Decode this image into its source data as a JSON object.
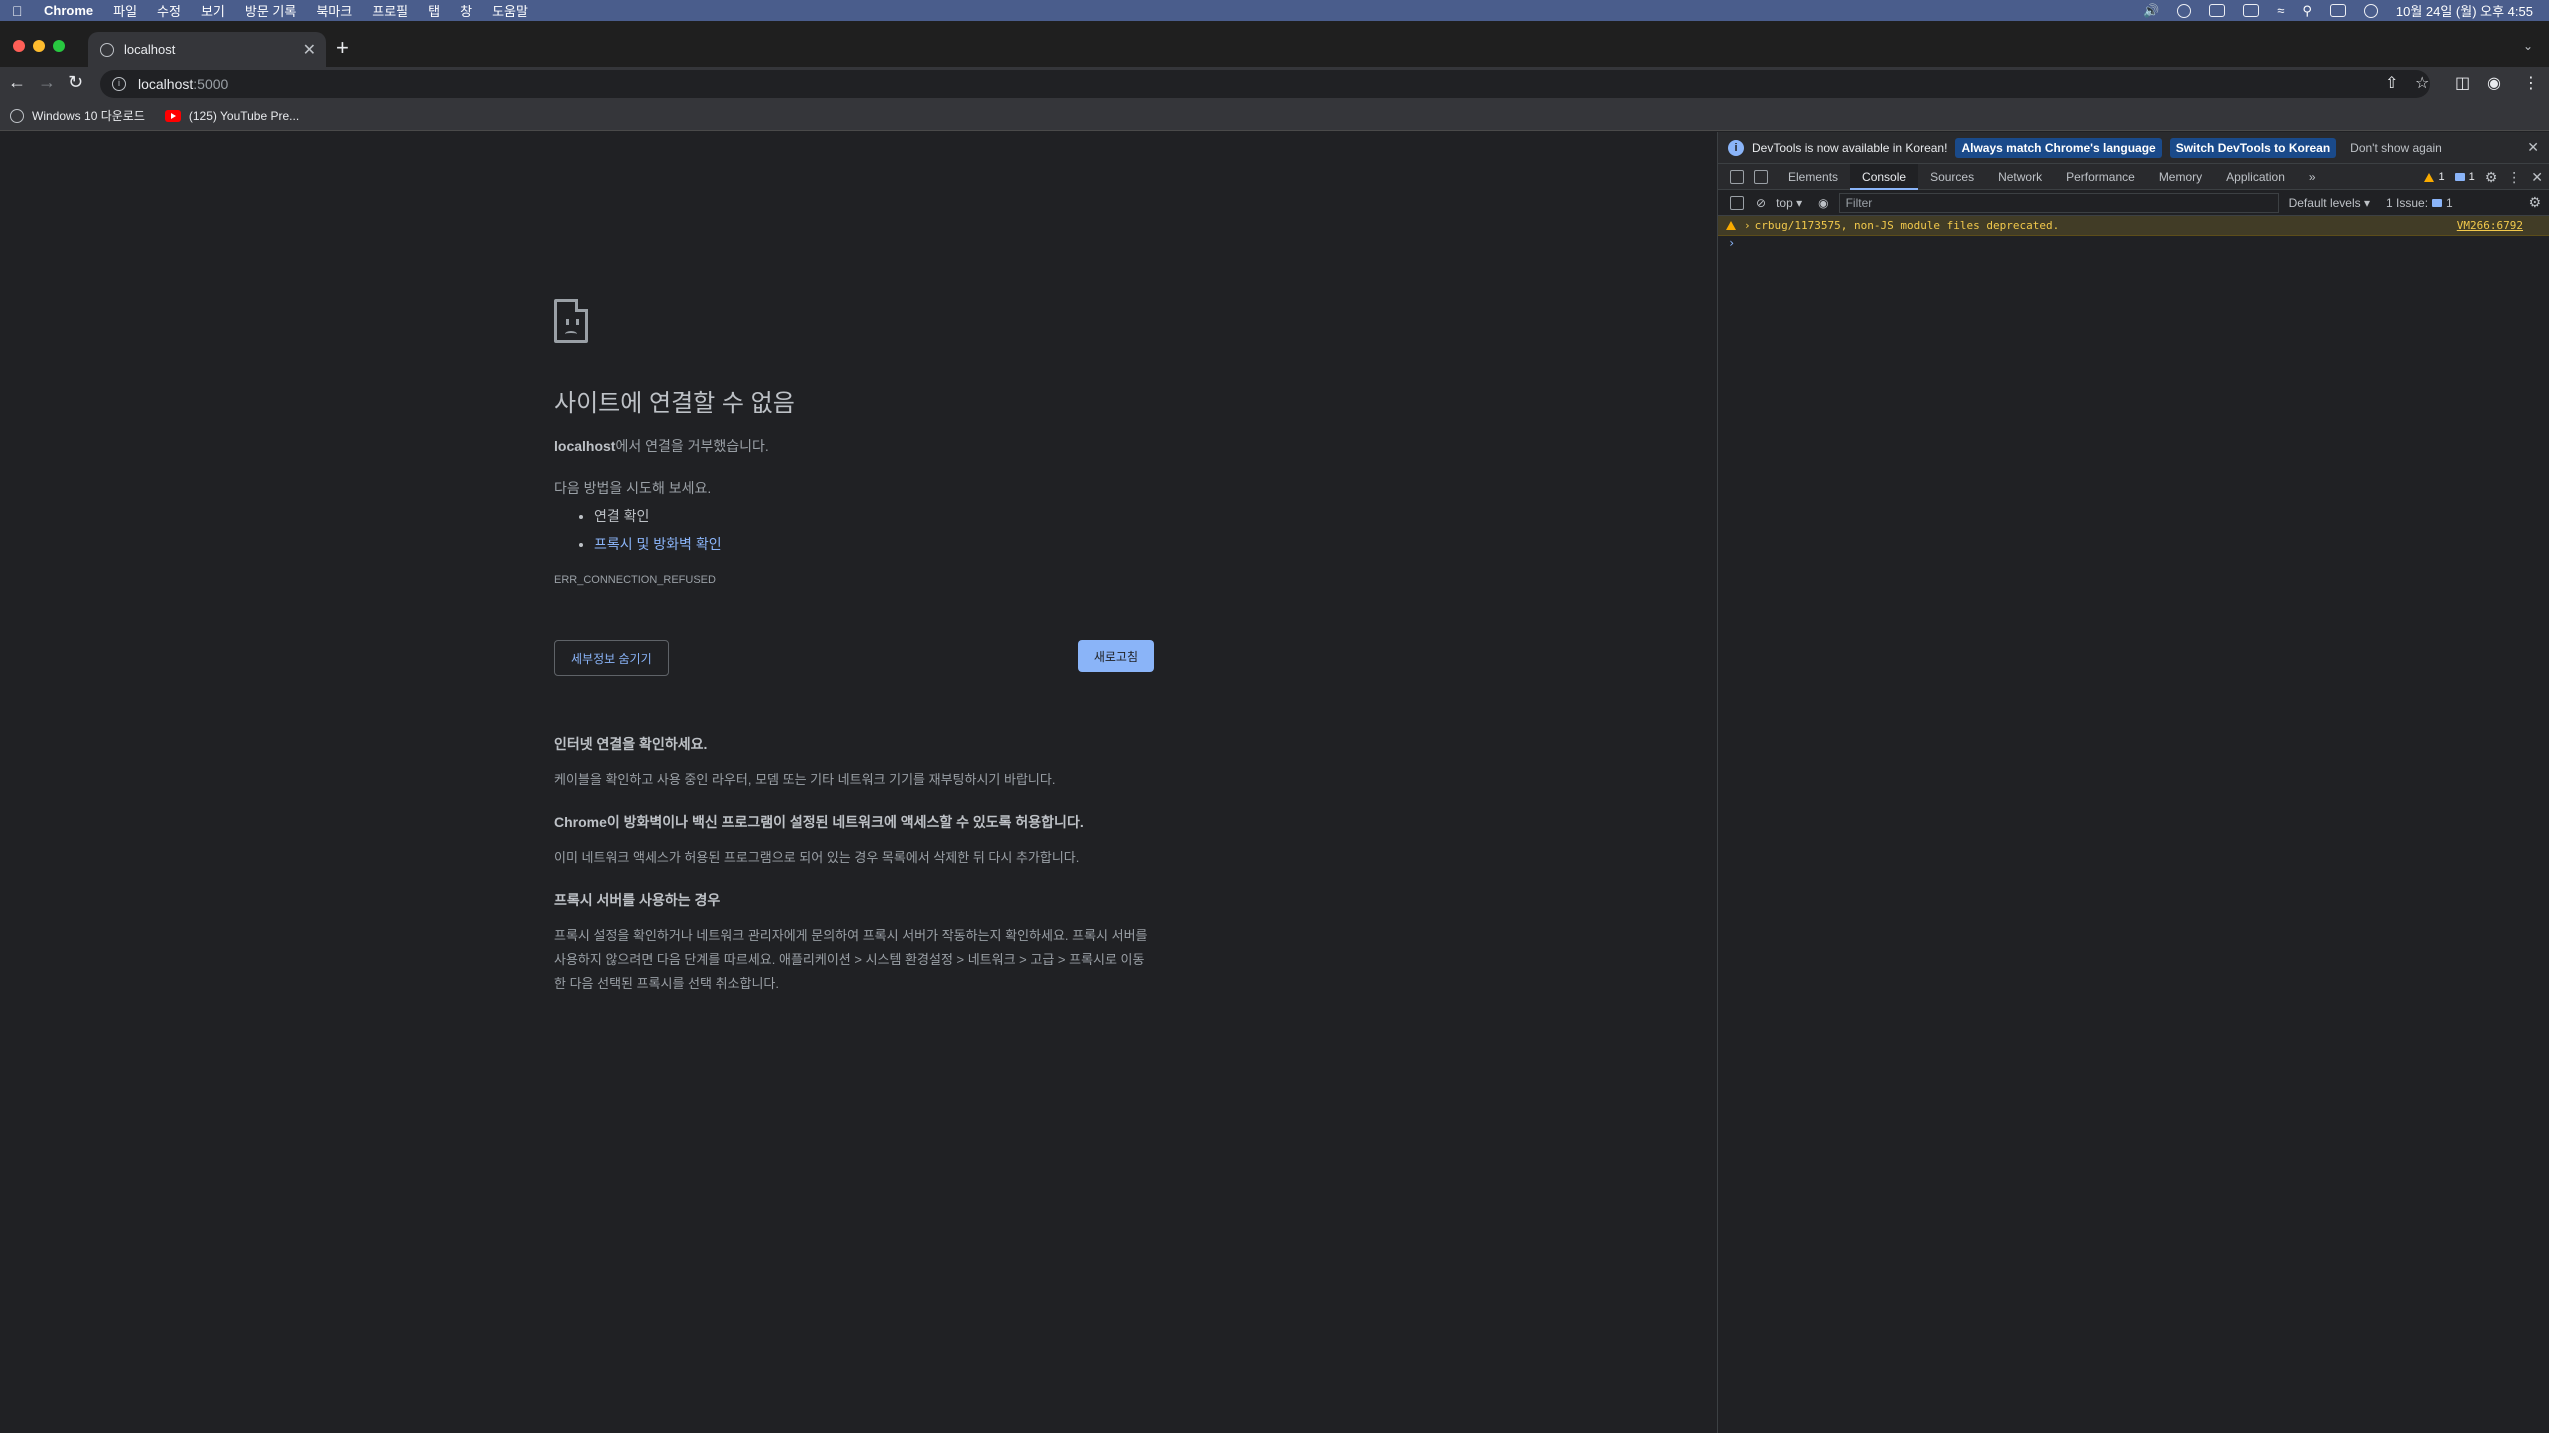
{
  "menubar": {
    "app": "Chrome",
    "items": [
      "파일",
      "수정",
      "보기",
      "방문 기록",
      "북마크",
      "프로필",
      "탭",
      "창",
      "도움말"
    ],
    "clock": "10월 24일 (월) 오후 4:55"
  },
  "tab": {
    "title": "localhost"
  },
  "omnibox": {
    "host": "localhost",
    "port": ":5000"
  },
  "bookmarks": [
    {
      "label": "Windows 10 다운로드"
    },
    {
      "label": "(125) YouTube Pre..."
    }
  ],
  "error": {
    "title": "사이트에 연결할 수 없음",
    "host": "localhost",
    "refused_text": "에서 연결을 거부했습니다.",
    "suggest_head": "다음 방법을 시도해 보세요.",
    "suggestion_1": "연결 확인",
    "suggestion_2": "프록시 및 방화벽 확인",
    "code": "ERR_CONNECTION_REFUSED",
    "details_button": "세부정보 숨기기",
    "reload_button": "새로고침",
    "details": [
      {
        "heading": "인터넷 연결을 확인하세요.",
        "body": "케이블을 확인하고 사용 중인 라우터, 모뎀 또는 기타 네트워크 기기를 재부팅하시기 바랍니다."
      },
      {
        "heading": "Chrome이 방화벽이나 백신 프로그램이 설정된 네트워크에 액세스할 수 있도록 허용합니다.",
        "body": "이미 네트워크 액세스가 허용된 프로그램으로 되어 있는 경우 목록에서 삭제한 뒤 다시 추가합니다."
      },
      {
        "heading": "프록시 서버를 사용하는 경우",
        "body": "프록시 설정을 확인하거나 네트워크 관리자에게 문의하여 프록시 서버가 작동하는지 확인하세요. 프록시 서버를 사용하지 않으려면 다음 단계를 따르세요. 애플리케이션 > 시스템 환경설정 > 네트워크 > 고급 > 프록시로 이동한 다음 선택된 프록시를 선택 취소합니다."
      }
    ]
  },
  "devtools": {
    "infobar": {
      "message": "DevTools is now available in Korean!",
      "btn_match": "Always match Chrome's language",
      "btn_switch": "Switch DevTools to Korean",
      "btn_dismiss": "Don't show again"
    },
    "tabs": [
      "Elements",
      "Console",
      "Sources",
      "Network",
      "Performance",
      "Memory",
      "Application"
    ],
    "more": "»",
    "warn_count": "1",
    "msg_count": "1",
    "context": "top ▾",
    "filter_placeholder": "Filter",
    "levels": "Default levels ▾",
    "issues_label": "1 Issue:",
    "issues_count": "1",
    "warning_text": "crbug/1173575, non-JS module files deprecated.",
    "warning_source": "VM266:6792"
  }
}
